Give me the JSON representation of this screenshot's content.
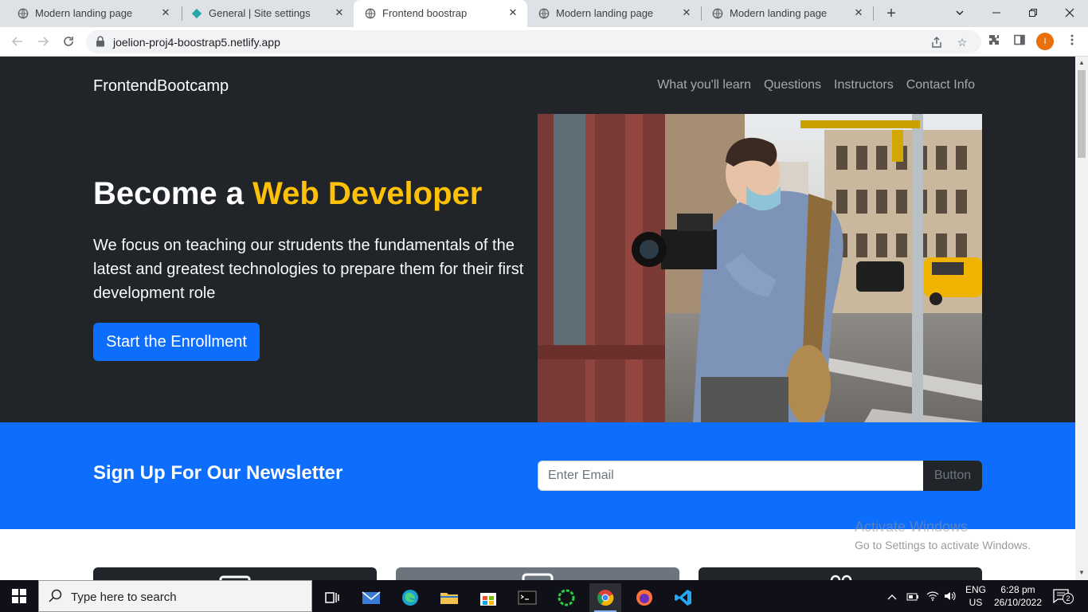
{
  "browser": {
    "tabs": [
      {
        "title": "Modern landing page",
        "active": false
      },
      {
        "title": "General | Site settings",
        "active": false
      },
      {
        "title": "Frontend boostrap",
        "active": true
      },
      {
        "title": "Modern landing page",
        "active": false
      },
      {
        "title": "Modern landing page",
        "active": false
      }
    ],
    "url": "joelion-proj4-boostrap5.netlify.app",
    "profile_initial": "I"
  },
  "page": {
    "brand": "FrontendBootcamp",
    "nav": [
      "What you'll learn",
      "Questions",
      "Instructors",
      "Contact Info"
    ],
    "hero": {
      "headline_prefix": "Become a ",
      "headline_highlight": "Web Developer",
      "lead": "We focus on teaching our strudents the fundamentals of the latest and greatest technologies to prepare them for their first development role",
      "cta_label": "Start the Enrollment"
    },
    "newsletter": {
      "title": "Sign Up For Our Newsletter",
      "email_placeholder": "Enter Email",
      "button_label": "Button"
    }
  },
  "watermark": {
    "line1": "Activate Windows",
    "line2": "Go to Settings to activate Windows."
  },
  "taskbar": {
    "search_placeholder": "Type here to search",
    "lang_top": "ENG",
    "lang_bottom": "US",
    "time": "6:28 pm",
    "date": "26/10/2022",
    "notification_count": "2"
  },
  "colors": {
    "dark": "#212529",
    "accent": "#0d6efd",
    "highlight": "#ffc107"
  }
}
